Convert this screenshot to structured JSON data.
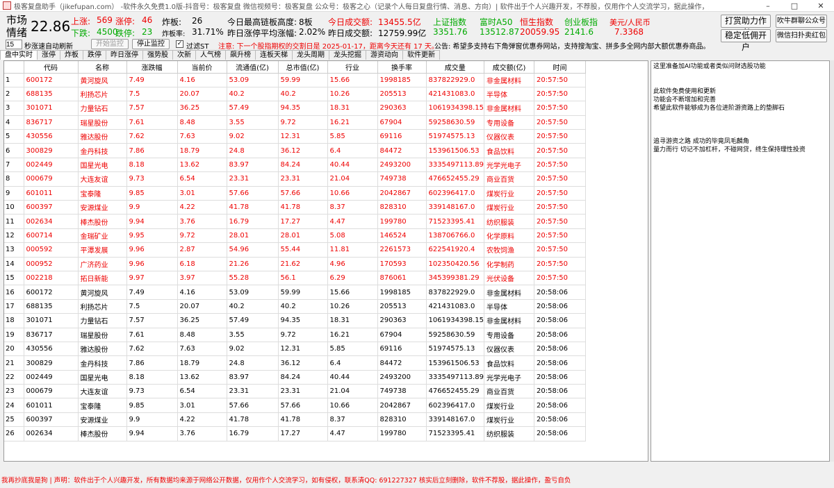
{
  "titlebar": {
    "title": "极客复盘助手（jikefupan.com） -软件永久免费1.0版-抖音号：极客复盘  微信视频号：极客复盘  公众号：极客之心（记录个人每日复盘行情、消息、方向）| 软件出于个人兴趣开发，不荐股，仅用作个人交流学习，据此操作，盈亏自负",
    "minimize": "–",
    "maximize": "□",
    "close": "✕"
  },
  "stats": {
    "mood_label_1": "市场",
    "mood_label_2": "情绪",
    "mood_value": "22.86",
    "up_label": "上涨:",
    "up_value": "569",
    "limit_up_label": "涨停:",
    "limit_up_value": "46",
    "down_label": "下跌:",
    "down_value": "4500",
    "limit_down_label": "跌停:",
    "limit_down_value": "23",
    "broken_label": "炸板:",
    "broken_value": "26",
    "broken_rate_label": "炸板率:",
    "broken_rate_value": "31.71%",
    "max_chain_label": "今日最高链板高度:",
    "max_chain_value": "8板",
    "prev_avg_label": "昨日涨停平均涨幅:",
    "prev_avg_value": "2.02%",
    "today_vol_label": "今日成交额:",
    "today_vol_value": "13455.5亿",
    "yest_vol_label": "昨日成交额:",
    "yest_vol_value": "12759.99亿",
    "indices": [
      {
        "name": "上证指数",
        "value": "3351.76"
      },
      {
        "name": "富时A50",
        "value": "13512.87"
      },
      {
        "name": "恒生指数",
        "value": "20059.95"
      },
      {
        "name": "创业板指",
        "value": "2141.6"
      },
      {
        "name": "美元/人民币",
        "value": "7.3368"
      }
    ],
    "btn_reward": "打赏助力作者",
    "btn_stable": "稳定低佣开户",
    "btn_wechat": "吹牛群聊公众号",
    "btn_redpack": "微信扫扑卖红包"
  },
  "controls": {
    "interval_value": "15",
    "interval_label": "秒涨速自动刷新",
    "start_btn": "开始监控",
    "stop_btn": "停止监控",
    "filter_st": "过滤ST",
    "notice": "注意: 下一个股指期权的交割日是 2025-01-17，距离今天还有 17 天。",
    "ad": "公告: 希望多支持右下角弹窗优惠券网站，支持搜淘宝、拼多多全网内部大额优惠券商品。"
  },
  "tabs": [
    "盘中实时",
    "涨停",
    "炸板",
    "跌停",
    "昨日涨停",
    "强势股",
    "次新",
    "人气榜",
    "飙升榜",
    "连板天梯",
    "龙头周期",
    "龙头挖掘",
    "游资动向",
    "软件更新"
  ],
  "columns": [
    "代码",
    "名称",
    "涨跌幅",
    "当前价",
    "流通值(亿)",
    "总市值(亿)",
    "行业",
    "换手率",
    "成交量",
    "成交额(亿)",
    "时间"
  ],
  "rows": [
    [
      "1",
      "600172",
      "黄河旋风",
      "7.49",
      "4.16",
      "53.09",
      "59.99",
      "15.66",
      "1998185",
      "837822929.0",
      "非金属材料",
      "20:57:50"
    ],
    [
      "2",
      "688135",
      "利扬芯片",
      "7.5",
      "20.07",
      "40.2",
      "40.2",
      "10.26",
      "205513",
      "421431083.0",
      "半导体",
      "20:57:50"
    ],
    [
      "3",
      "301071",
      "力量钻石",
      "7.57",
      "36.25",
      "57.49",
      "94.35",
      "18.31",
      "290363",
      "1061934398.15",
      "非金属材料",
      "20:57:50"
    ],
    [
      "4",
      "836717",
      "瑞星股份",
      "7.61",
      "8.48",
      "3.55",
      "9.72",
      "16.21",
      "67904",
      "59258630.59",
      "专用设备",
      "20:57:50"
    ],
    [
      "5",
      "430556",
      "雅达股份",
      "7.62",
      "7.63",
      "9.02",
      "12.31",
      "5.85",
      "69116",
      "51974575.13",
      "仪器仪表",
      "20:57:50"
    ],
    [
      "6",
      "300829",
      "金丹科技",
      "7.86",
      "18.79",
      "24.8",
      "36.12",
      "6.4",
      "84472",
      "153961506.53",
      "食品饮料",
      "20:57:50"
    ],
    [
      "7",
      "002449",
      "国星光电",
      "8.18",
      "13.62",
      "83.97",
      "84.24",
      "40.44",
      "2493200",
      "3335497113.89",
      "光学光电子",
      "20:57:50"
    ],
    [
      "8",
      "000679",
      "大连友谊",
      "9.73",
      "6.54",
      "23.31",
      "23.31",
      "21.04",
      "749738",
      "476652455.29",
      "商业百货",
      "20:57:50"
    ],
    [
      "9",
      "601011",
      "宝泰隆",
      "9.85",
      "3.01",
      "57.66",
      "57.66",
      "10.66",
      "2042867",
      "602396417.0",
      "煤炭行业",
      "20:57:50"
    ],
    [
      "10",
      "600397",
      "安源煤业",
      "9.9",
      "4.22",
      "41.78",
      "41.78",
      "8.37",
      "828310",
      "339148167.0",
      "煤炭行业",
      "20:57:50"
    ],
    [
      "11",
      "002634",
      "棒杰股份",
      "9.94",
      "3.76",
      "16.79",
      "17.27",
      "4.47",
      "199780",
      "71523395.41",
      "纺织服装",
      "20:57:50"
    ],
    [
      "12",
      "600714",
      "金瑞矿业",
      "9.95",
      "9.72",
      "28.01",
      "28.01",
      "5.08",
      "146524",
      "138706766.0",
      "化学原料",
      "20:57:50"
    ],
    [
      "13",
      "000592",
      "平潭发展",
      "9.96",
      "2.87",
      "54.96",
      "55.44",
      "11.81",
      "2261573",
      "622541920.4",
      "农牧饲渔",
      "20:57:50"
    ],
    [
      "14",
      "000952",
      "广济药业",
      "9.96",
      "6.18",
      "21.26",
      "21.62",
      "4.96",
      "170593",
      "102350420.56",
      "化学制药",
      "20:57:50"
    ],
    [
      "15",
      "002218",
      "拓日新能",
      "9.97",
      "3.97",
      "55.28",
      "56.1",
      "6.29",
      "876061",
      "345399381.29",
      "光伏设备",
      "20:57:50"
    ],
    [
      "16",
      "600172",
      "黄河旋风",
      "7.49",
      "4.16",
      "53.09",
      "59.99",
      "15.66",
      "1998185",
      "837822929.0",
      "非金属材料",
      "20:58:06"
    ],
    [
      "17",
      "688135",
      "利扬芯片",
      "7.5",
      "20.07",
      "40.2",
      "40.2",
      "10.26",
      "205513",
      "421431083.0",
      "半导体",
      "20:58:06"
    ],
    [
      "18",
      "301071",
      "力量钻石",
      "7.57",
      "36.25",
      "57.49",
      "94.35",
      "18.31",
      "290363",
      "1061934398.15",
      "非金属材料",
      "20:58:06"
    ],
    [
      "19",
      "836717",
      "瑞星股份",
      "7.61",
      "8.48",
      "3.55",
      "9.72",
      "16.21",
      "67904",
      "59258630.59",
      "专用设备",
      "20:58:06"
    ],
    [
      "20",
      "430556",
      "雅达股份",
      "7.62",
      "7.63",
      "9.02",
      "12.31",
      "5.85",
      "69116",
      "51974575.13",
      "仪器仪表",
      "20:58:06"
    ],
    [
      "21",
      "300829",
      "金丹科技",
      "7.86",
      "18.79",
      "24.8",
      "36.12",
      "6.4",
      "84472",
      "153961506.53",
      "食品饮料",
      "20:58:06"
    ],
    [
      "22",
      "002449",
      "国星光电",
      "8.18",
      "13.62",
      "83.97",
      "84.24",
      "40.44",
      "2493200",
      "3335497113.89",
      "光学光电子",
      "20:58:06"
    ],
    [
      "23",
      "000679",
      "大连友谊",
      "9.73",
      "6.54",
      "23.31",
      "23.31",
      "21.04",
      "749738",
      "476652455.29",
      "商业百货",
      "20:58:06"
    ],
    [
      "24",
      "601011",
      "宝泰隆",
      "9.85",
      "3.01",
      "57.66",
      "57.66",
      "10.66",
      "2042867",
      "602396417.0",
      "煤炭行业",
      "20:58:06"
    ],
    [
      "25",
      "600397",
      "安源煤业",
      "9.9",
      "4.22",
      "41.78",
      "41.78",
      "8.37",
      "828310",
      "339148167.0",
      "煤炭行业",
      "20:58:06"
    ],
    [
      "26",
      "002634",
      "棒杰股份",
      "9.94",
      "3.76",
      "16.79",
      "17.27",
      "4.47",
      "199780",
      "71523395.41",
      "纺织服装",
      "20:58:06"
    ]
  ],
  "hot_row_count": 15,
  "side_panel": [
    "这里准备加AI功能或者类似问财选股功能",
    "",
    "",
    "此软件免费使用和更新",
    "功能会不断增加和完善",
    "希望此软件能够成为各位进阶游资路上的垫脚石",
    "",
    "",
    "",
    "追寻游资之路 成功的毕竟凤毛麟角",
    "量力而行 切记不加杠杆，不碰网贷，终生保持理性投资"
  ],
  "footer": "我再抄底我是狗 | 声明：软件出于个人兴趣开发，所有数据均来源于网络公开数据，仅用作个人交流学习，如有侵权，联系清QQ: 691227327 核实后立刻删除，软件不荐股，据此操作，盈亏自负",
  "colors": {
    "up": "#e00000",
    "down": "#00a000",
    "accent_red": "#e00000"
  }
}
